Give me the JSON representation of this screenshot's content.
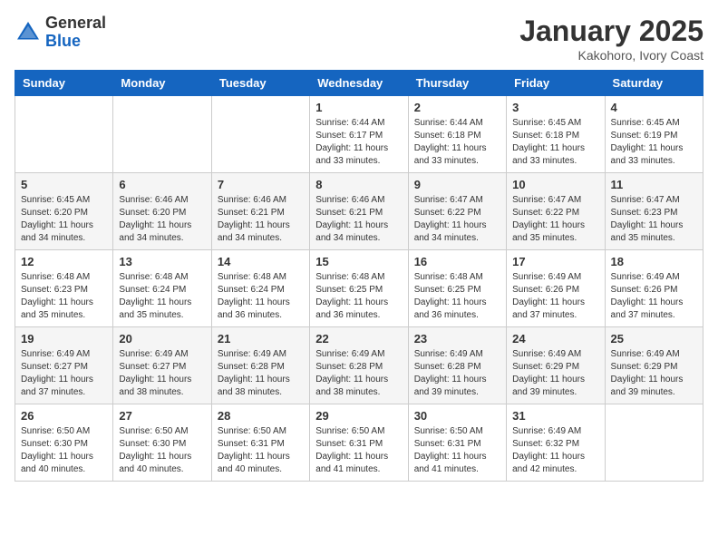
{
  "header": {
    "logo_general": "General",
    "logo_blue": "Blue",
    "month_title": "January 2025",
    "location": "Kakohoro, Ivory Coast"
  },
  "weekdays": [
    "Sunday",
    "Monday",
    "Tuesday",
    "Wednesday",
    "Thursday",
    "Friday",
    "Saturday"
  ],
  "weeks": [
    [
      {
        "day": "",
        "info": ""
      },
      {
        "day": "",
        "info": ""
      },
      {
        "day": "",
        "info": ""
      },
      {
        "day": "1",
        "info": "Sunrise: 6:44 AM\nSunset: 6:17 PM\nDaylight: 11 hours\nand 33 minutes."
      },
      {
        "day": "2",
        "info": "Sunrise: 6:44 AM\nSunset: 6:18 PM\nDaylight: 11 hours\nand 33 minutes."
      },
      {
        "day": "3",
        "info": "Sunrise: 6:45 AM\nSunset: 6:18 PM\nDaylight: 11 hours\nand 33 minutes."
      },
      {
        "day": "4",
        "info": "Sunrise: 6:45 AM\nSunset: 6:19 PM\nDaylight: 11 hours\nand 33 minutes."
      }
    ],
    [
      {
        "day": "5",
        "info": "Sunrise: 6:45 AM\nSunset: 6:20 PM\nDaylight: 11 hours\nand 34 minutes."
      },
      {
        "day": "6",
        "info": "Sunrise: 6:46 AM\nSunset: 6:20 PM\nDaylight: 11 hours\nand 34 minutes."
      },
      {
        "day": "7",
        "info": "Sunrise: 6:46 AM\nSunset: 6:21 PM\nDaylight: 11 hours\nand 34 minutes."
      },
      {
        "day": "8",
        "info": "Sunrise: 6:46 AM\nSunset: 6:21 PM\nDaylight: 11 hours\nand 34 minutes."
      },
      {
        "day": "9",
        "info": "Sunrise: 6:47 AM\nSunset: 6:22 PM\nDaylight: 11 hours\nand 34 minutes."
      },
      {
        "day": "10",
        "info": "Sunrise: 6:47 AM\nSunset: 6:22 PM\nDaylight: 11 hours\nand 35 minutes."
      },
      {
        "day": "11",
        "info": "Sunrise: 6:47 AM\nSunset: 6:23 PM\nDaylight: 11 hours\nand 35 minutes."
      }
    ],
    [
      {
        "day": "12",
        "info": "Sunrise: 6:48 AM\nSunset: 6:23 PM\nDaylight: 11 hours\nand 35 minutes."
      },
      {
        "day": "13",
        "info": "Sunrise: 6:48 AM\nSunset: 6:24 PM\nDaylight: 11 hours\nand 35 minutes."
      },
      {
        "day": "14",
        "info": "Sunrise: 6:48 AM\nSunset: 6:24 PM\nDaylight: 11 hours\nand 36 minutes."
      },
      {
        "day": "15",
        "info": "Sunrise: 6:48 AM\nSunset: 6:25 PM\nDaylight: 11 hours\nand 36 minutes."
      },
      {
        "day": "16",
        "info": "Sunrise: 6:48 AM\nSunset: 6:25 PM\nDaylight: 11 hours\nand 36 minutes."
      },
      {
        "day": "17",
        "info": "Sunrise: 6:49 AM\nSunset: 6:26 PM\nDaylight: 11 hours\nand 37 minutes."
      },
      {
        "day": "18",
        "info": "Sunrise: 6:49 AM\nSunset: 6:26 PM\nDaylight: 11 hours\nand 37 minutes."
      }
    ],
    [
      {
        "day": "19",
        "info": "Sunrise: 6:49 AM\nSunset: 6:27 PM\nDaylight: 11 hours\nand 37 minutes."
      },
      {
        "day": "20",
        "info": "Sunrise: 6:49 AM\nSunset: 6:27 PM\nDaylight: 11 hours\nand 38 minutes."
      },
      {
        "day": "21",
        "info": "Sunrise: 6:49 AM\nSunset: 6:28 PM\nDaylight: 11 hours\nand 38 minutes."
      },
      {
        "day": "22",
        "info": "Sunrise: 6:49 AM\nSunset: 6:28 PM\nDaylight: 11 hours\nand 38 minutes."
      },
      {
        "day": "23",
        "info": "Sunrise: 6:49 AM\nSunset: 6:28 PM\nDaylight: 11 hours\nand 39 minutes."
      },
      {
        "day": "24",
        "info": "Sunrise: 6:49 AM\nSunset: 6:29 PM\nDaylight: 11 hours\nand 39 minutes."
      },
      {
        "day": "25",
        "info": "Sunrise: 6:49 AM\nSunset: 6:29 PM\nDaylight: 11 hours\nand 39 minutes."
      }
    ],
    [
      {
        "day": "26",
        "info": "Sunrise: 6:50 AM\nSunset: 6:30 PM\nDaylight: 11 hours\nand 40 minutes."
      },
      {
        "day": "27",
        "info": "Sunrise: 6:50 AM\nSunset: 6:30 PM\nDaylight: 11 hours\nand 40 minutes."
      },
      {
        "day": "28",
        "info": "Sunrise: 6:50 AM\nSunset: 6:31 PM\nDaylight: 11 hours\nand 40 minutes."
      },
      {
        "day": "29",
        "info": "Sunrise: 6:50 AM\nSunset: 6:31 PM\nDaylight: 11 hours\nand 41 minutes."
      },
      {
        "day": "30",
        "info": "Sunrise: 6:50 AM\nSunset: 6:31 PM\nDaylight: 11 hours\nand 41 minutes."
      },
      {
        "day": "31",
        "info": "Sunrise: 6:49 AM\nSunset: 6:32 PM\nDaylight: 11 hours\nand 42 minutes."
      },
      {
        "day": "",
        "info": ""
      }
    ]
  ]
}
